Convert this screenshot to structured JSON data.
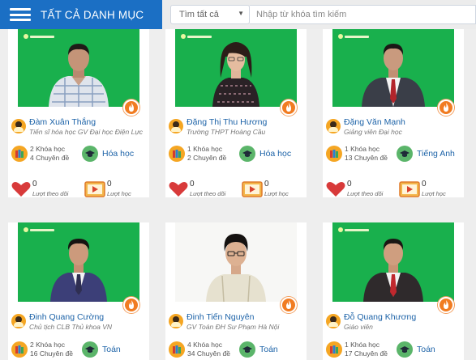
{
  "header": {
    "category_label": "TẤT CẢ DANH MỤC",
    "search_scope": "Tìm tất cả",
    "search_placeholder": "Nhập từ khóa tìm kiếm"
  },
  "labels": {
    "followers": "Lượt theo dõi",
    "views": "Lượt học"
  },
  "colors": {
    "brand_blue": "#1b6fc4",
    "photo_green": "#19b04d",
    "fire_orange": "#f17c22",
    "link_blue": "#1d63a8"
  },
  "teachers": [
    {
      "name": "Đàm Xuân Thắng",
      "title": "Tiến sĩ hóa học GV Đại học Điện Lực",
      "courses": "2 Khóa học",
      "topics": "4 Chuyên đề",
      "subject": "Hóa học",
      "followers": "0",
      "views": "0"
    },
    {
      "name": "Đặng Thị Thu Hương",
      "title": "Trường THPT Hoàng Cầu",
      "courses": "1 Khóa học",
      "topics": "2 Chuyên đề",
      "subject": "Hóa học",
      "followers": "0",
      "views": "0"
    },
    {
      "name": "Đặng Văn Mạnh",
      "title": "Giảng viên Đại học",
      "courses": "1 Khóa học",
      "topics": "13 Chuyên đề",
      "subject": "Tiếng Anh",
      "followers": "0",
      "views": "0"
    },
    {
      "name": "Đinh Quang Cường",
      "title": "Chủ tịch CLB Thủ khoa VN",
      "courses": "2 Khóa học",
      "topics": "16 Chuyên đề",
      "subject": "Toán"
    },
    {
      "name": "Đinh Tiến Nguyên",
      "title": "GV Toán ĐH Sư Phạm Hà Nội",
      "courses": "4 Khóa học",
      "topics": "34 Chuyên đề",
      "subject": "Toán"
    },
    {
      "name": "Đỗ Quang Khương",
      "title": "Giáo viên",
      "courses": "1 Khóa học",
      "topics": "17 Chuyên đề",
      "subject": "Toán"
    }
  ]
}
